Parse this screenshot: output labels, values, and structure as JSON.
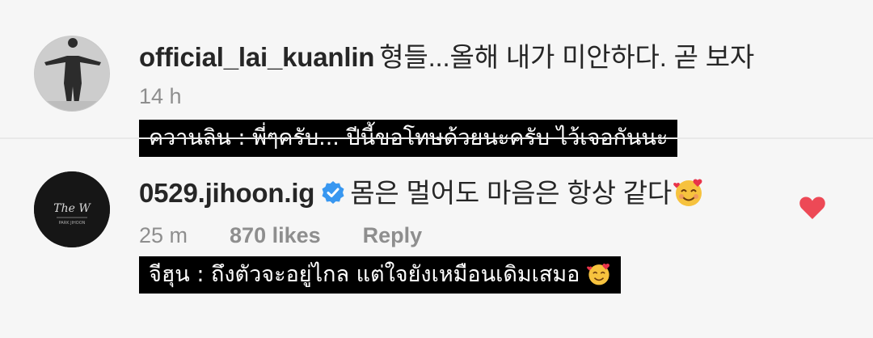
{
  "comments": [
    {
      "username": "official_lai_kuanlin",
      "text": "형들...올해 내가 미안하다. 곧 보자",
      "time": "14 h",
      "translation": "ควานลิน : พี่ๆครับ... ปีนี้ขอโทษด้วยนะครับ ไว้เจอกันนะ"
    },
    {
      "username": "0529.jihoon.ig",
      "text": "몸은 멀어도 마음은 항상 같다",
      "time": "25 m",
      "likes": "870 likes",
      "reply_label": "Reply",
      "translation": "จีฮุน : ถึงตัวจะอยู่ไกล แต่ใจยังเหมือนเดิมเสมอ",
      "liked": true,
      "avatar_text": "The W"
    }
  ],
  "colors": {
    "heart": "#ed4956",
    "verified": "#3897f0",
    "meta": "#8e8e8e"
  }
}
